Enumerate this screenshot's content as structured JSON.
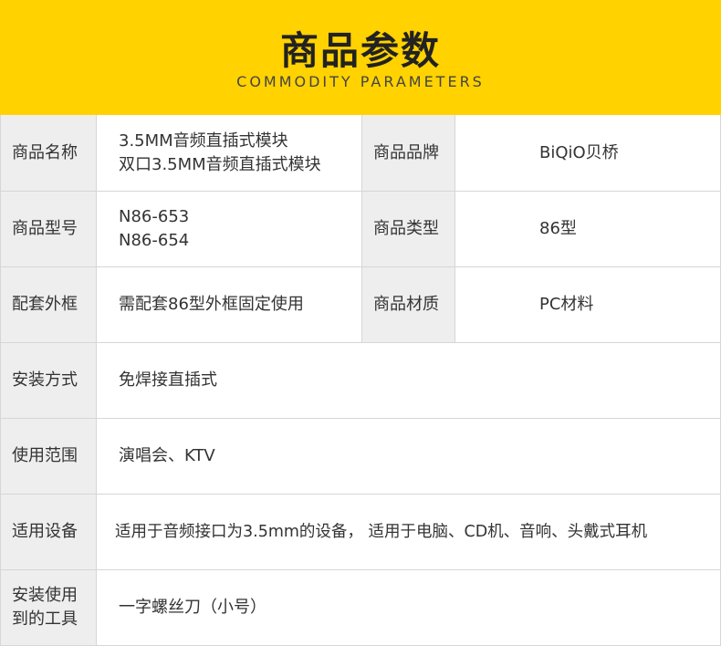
{
  "header": {
    "title": "商品参数",
    "subtitle": "COMMODITY PARAMETERS"
  },
  "rows": {
    "name": {
      "label": "商品名称",
      "value_line1": "3.5MM音频直插式模块",
      "value_line2": "双口3.5MM音频直插式模块",
      "label2": "商品品牌",
      "value2": "BiQiO贝桥"
    },
    "model": {
      "label": "商品型号",
      "value_line1": "N86-653",
      "value_line2": "N86-654",
      "label2": "商品类型",
      "value2": "86型"
    },
    "frame": {
      "label": "配套外框",
      "value": "需配套86型外框固定使用",
      "label2": "商品材质",
      "value2": "PC材料"
    },
    "install": {
      "label": "安装方式",
      "value": "免焊接直插式"
    },
    "scope": {
      "label": "使用范围",
      "value": "演唱会、KTV"
    },
    "devices": {
      "label": "适用设备",
      "value": "适用于音频接口为3.5mm的设备， 适用于电脑、CD机、音响、头戴式耳机"
    },
    "tools": {
      "label_line1": "安装使用",
      "label_line2": "到的工具",
      "value": "一字螺丝刀（小号）"
    }
  },
  "colors": {
    "header_bg": "#ffd200",
    "label_bg": "#eeeeee",
    "border": "#d6d6d6"
  }
}
